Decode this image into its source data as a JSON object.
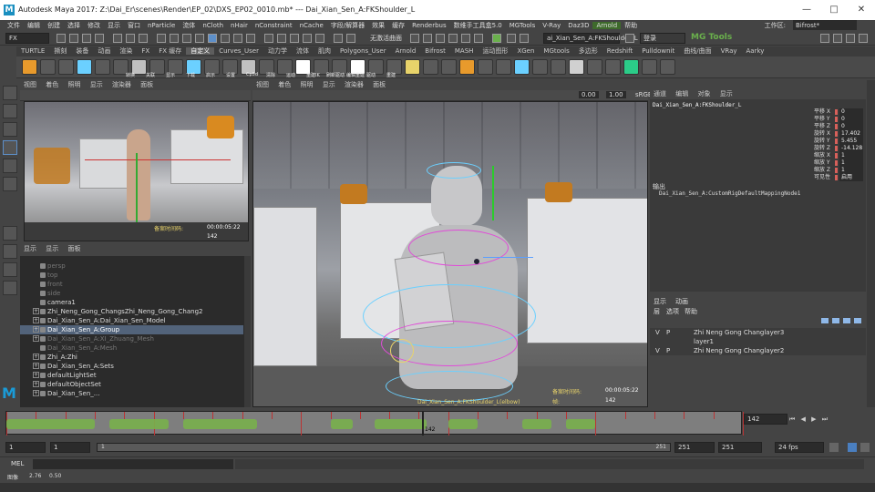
{
  "window": {
    "title": "Autodesk Maya 2017: Z:\\Dai_Er\\scenes\\Render\\EP_02\\DXS_EP02_0010.mb* --- Dai_Xian_Sen_A:FKShoulder_L",
    "logo": "M",
    "controls": [
      "—",
      "□",
      "✕"
    ]
  },
  "menubar": {
    "items": [
      "文件",
      "编辑",
      "创建",
      "选择",
      "修改",
      "显示",
      "窗口",
      "nParticle",
      "流体",
      "nCloth",
      "nHair",
      "nConstraint",
      "nCache",
      "字段/解算器",
      "效果",
      "缓存",
      "Renderbus",
      "数维手工具盒5.0",
      "MGTools",
      "V-Ray",
      "Daz3D",
      "Arnold",
      "帮助"
    ],
    "workspace_label": "工作区:",
    "workspace_value": "Bifrost*"
  },
  "statusline": {
    "mode": "FX",
    "live_surface": "无激活曲面",
    "object_field": "ai_Xian_Sen_A:FKShoulder_L",
    "login": "登录",
    "brand": "MG Tools"
  },
  "shelf": {
    "tabs": [
      "TURTLE",
      "撕刻",
      "装备",
      "动画",
      "渲染",
      "FX",
      "FX 缓存",
      "自定义",
      "Curves_User",
      "动力学",
      "流体",
      "肌肉",
      "Polygons_User",
      "Arnold",
      "Bifrost",
      "MASH",
      "运动图形",
      "XGen",
      "MGtools",
      "多边形",
      "Redshift",
      "Pulldownit",
      "曲线/曲面",
      "VRay",
      "Aarky"
    ],
    "active_tab": "自定义",
    "icon_labels": [
      "转换",
      "关联",
      "显示",
      "下载",
      "启示",
      "设置",
      "Cp5d",
      "清除",
      "运动",
      "重建IK",
      "刷新驱动",
      "编辑重建",
      "驱动",
      "重建"
    ]
  },
  "left_viewport": {
    "menu": [
      "视图",
      "着色",
      "照明",
      "显示",
      "渲染器",
      "面板"
    ],
    "hud": {
      "label": "备案时间码:",
      "timecode": "00:00:05:22",
      "frame": "142"
    }
  },
  "main_viewport": {
    "menu": [
      "视图",
      "着色",
      "照明",
      "显示",
      "渲染器",
      "面板"
    ],
    "exposure": "0.00",
    "gamma": "1.00",
    "color_space": "sRGB",
    "hud": {
      "object": "Dai_Xian_Sen_A:FKShoulder_L(elbow)",
      "label": "备案时间码:",
      "timecode": "00:00:05:22",
      "frame_label": "帧:",
      "frame": "142"
    }
  },
  "outliner": {
    "menu": [
      "显示",
      "显示",
      "面板"
    ],
    "rows": [
      {
        "label": "persp",
        "dim": true,
        "expander": false
      },
      {
        "label": "top",
        "dim": true,
        "expander": false
      },
      {
        "label": "front",
        "dim": true,
        "expander": false
      },
      {
        "label": "side",
        "dim": true,
        "expander": false
      },
      {
        "label": "camera1",
        "dim": false,
        "expander": false
      },
      {
        "label": "Zhi_Neng_Gong_ChangsZhi_Neng_Gong_Chang2",
        "dim": false,
        "expander": true
      },
      {
        "label": "Dai_Xian_Sen_A:Dai_Xian_Sen_Model",
        "dim": false,
        "expander": true
      },
      {
        "label": "Dai_Xian_Sen_A:Group",
        "dim": false,
        "expander": true,
        "selected": true
      },
      {
        "label": "Dai_Xian_Sen_A:XI_Zhuang_Mesh",
        "dim": true,
        "expander": true
      },
      {
        "label": "Dai_Xian_Sen_A:Mesh",
        "dim": true,
        "expander": false
      },
      {
        "label": "Zhi_A:Zhi",
        "dim": false,
        "expander": true
      },
      {
        "label": "Dai_Xian_Sen_A:Sets",
        "dim": false,
        "expander": true
      },
      {
        "label": "defaultLightSet",
        "dim": false,
        "expander": true
      },
      {
        "label": "defaultObjectSet",
        "dim": false,
        "expander": true
      },
      {
        "label": "Dai_Xian_Sen_...",
        "dim": false,
        "expander": true
      }
    ]
  },
  "channelbox": {
    "menu": [
      "通道",
      "编辑",
      "对象",
      "显示"
    ],
    "object": "Dai_Xian_Sen_A:FKShoulder_L",
    "channels": [
      {
        "label": "平移 X",
        "value": "0"
      },
      {
        "label": "平移 Y",
        "value": "0"
      },
      {
        "label": "平移 Z",
        "value": "0"
      },
      {
        "label": "旋转 X",
        "value": "17.402"
      },
      {
        "label": "旋转 Y",
        "value": "5.455"
      },
      {
        "label": "旋转 Z",
        "value": "-14.128"
      },
      {
        "label": "缩放 X",
        "value": "1"
      },
      {
        "label": "缩放 Y",
        "value": "1"
      },
      {
        "label": "缩放 Z",
        "value": "1"
      },
      {
        "label": "可见性",
        "value": "启用"
      }
    ],
    "outputs_label": "输出",
    "output_node": "Dai_Xian_Sen_A:CustomRigDefaultMappingNode1"
  },
  "layer_editor": {
    "tabs": [
      "显示",
      "动画"
    ],
    "menu": [
      "层",
      "选项",
      "帮助"
    ],
    "layers": [
      {
        "v": "V",
        "p": "P",
        "name": "Zhi Neng Gong Changlayer3"
      },
      {
        "v": "",
        "p": "",
        "name": "layer1"
      },
      {
        "v": "V",
        "p": "P",
        "name": "Zhi Neng Gong Changlayer2"
      }
    ]
  },
  "timeslider": {
    "current_frame": "142",
    "current_frame_field": "142",
    "range_start_outer": "1",
    "range_start_inner": "1",
    "range_slider_start": "1",
    "range_slider_end": "251",
    "range_end_inner": "251",
    "range_end_outer": "251",
    "fps": "24 fps",
    "current_frame_norm": 0.564
  },
  "cmdline": {
    "label": "MEL"
  },
  "helpline": {
    "text": "图像",
    "v1": "2.76",
    "v2": "0.50"
  },
  "colors": {
    "accent_green": "#6ab04c",
    "selection_blue": "#52637a",
    "keyframe_red": "#b33333",
    "hud_yellow": "#e8d36a"
  }
}
